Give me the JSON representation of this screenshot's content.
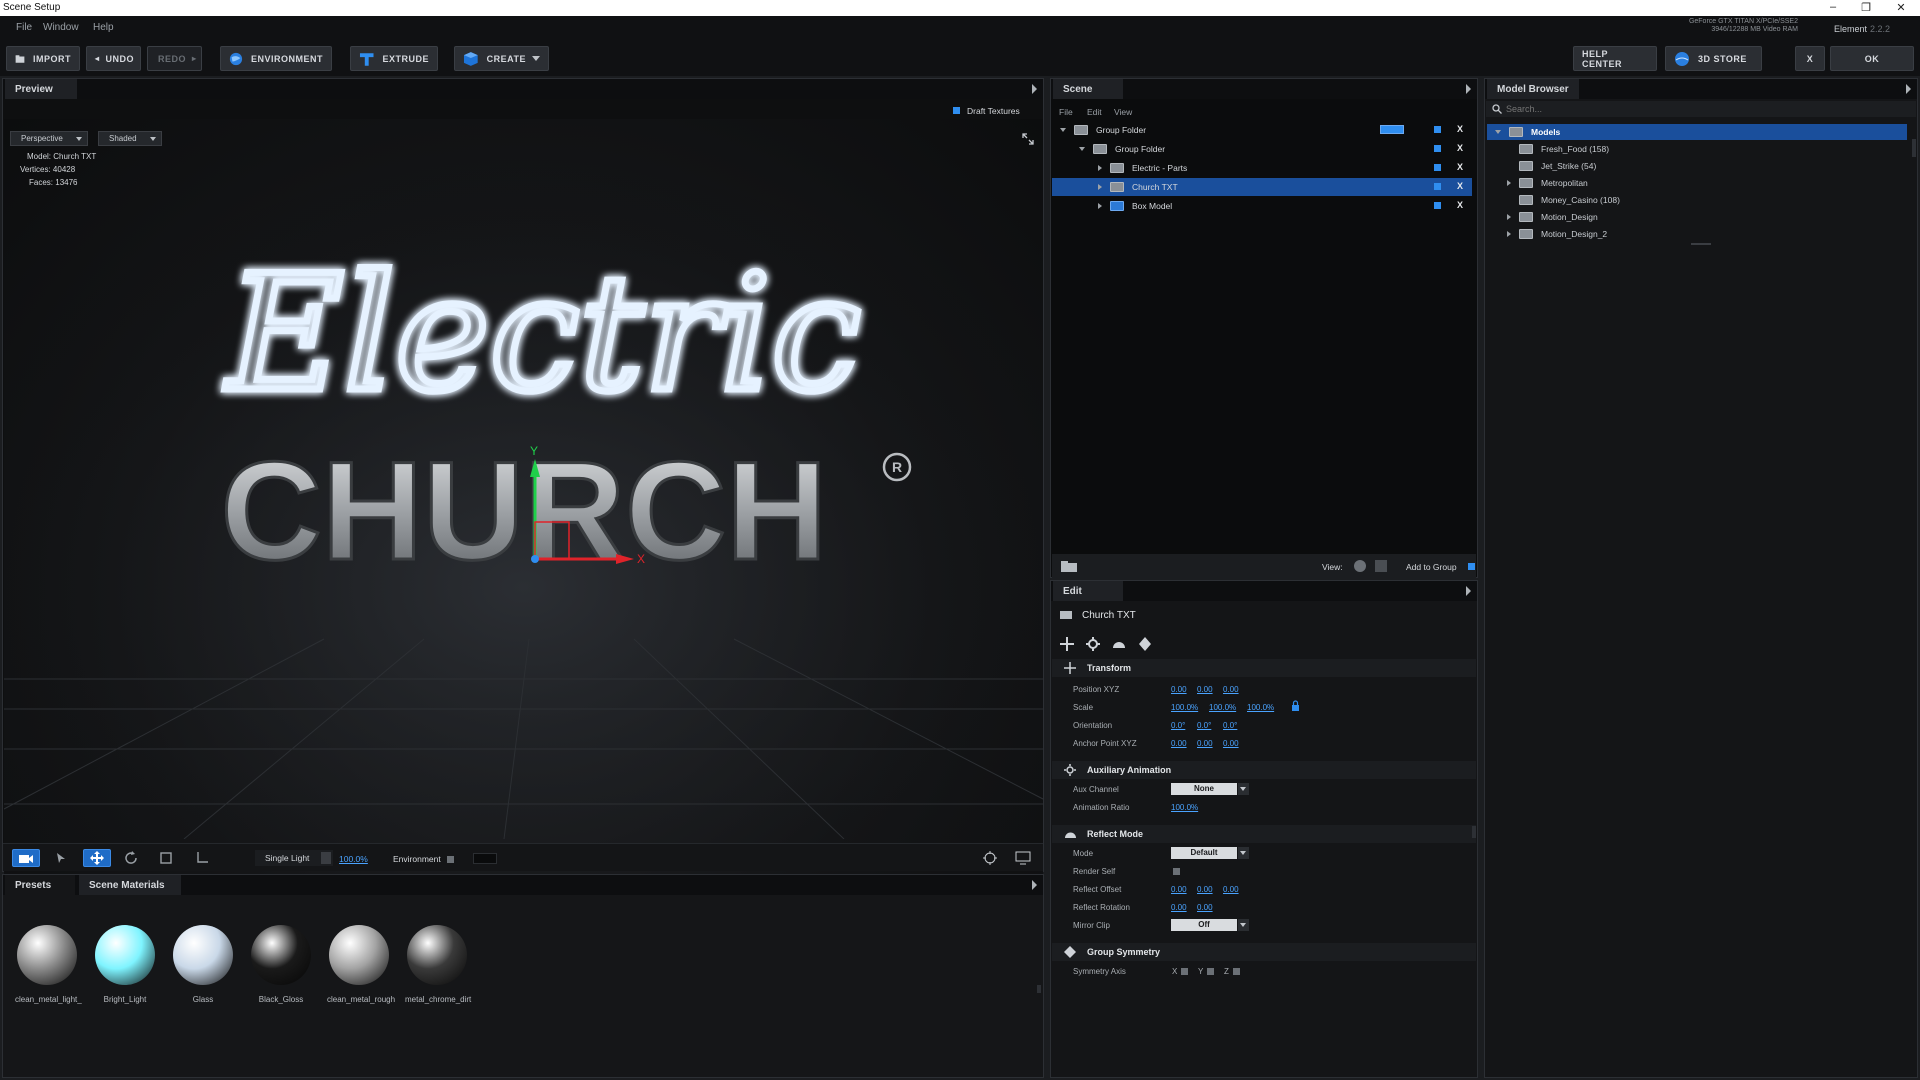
{
  "window": {
    "title": "Scene Setup",
    "controls": [
      "–",
      "❐",
      "✕"
    ]
  },
  "menu": [
    "File",
    "Window",
    "Help"
  ],
  "system": {
    "gpu_line1": "GeForce GTX TITAN X/PCIe/SSE2",
    "gpu_line2": "3946/12288 MB Video RAM",
    "app_name": "Element",
    "app_version": "2.2.2"
  },
  "toolbar": {
    "import": "IMPORT",
    "undo": "UNDO",
    "redo": "REDO",
    "environment": "ENVIRONMENT",
    "extrude": "EXTRUDE",
    "create": "CREATE",
    "help_center": "HELP CENTER",
    "store": "3D STORE",
    "close": "X",
    "ok": "OK"
  },
  "preview": {
    "tab": "Preview",
    "draft_textures": "Draft Textures",
    "camera": "Perspective",
    "shading": "Shaded",
    "info": {
      "model_label": "Model:",
      "model": "Church TXT",
      "vertices_label": "Vertices:",
      "vertices": "40428",
      "faces_label": "Faces:",
      "faces": "13476"
    },
    "scene_text_script": "Electric",
    "scene_text_block": "CHURCH",
    "registered_mark": "R",
    "axis_y": "Y",
    "axis_x": "X",
    "light_mode": "Single Light",
    "light_intensity": "100.0%",
    "environment_label": "Environment"
  },
  "materials": {
    "tabs": [
      "Presets",
      "Scene Materials"
    ],
    "items": [
      {
        "name": "clean_metal_light_",
        "color": "#8c8c8c"
      },
      {
        "name": "Bright_Light",
        "color": "#7ff4ff"
      },
      {
        "name": "Glass",
        "color": "#c9d8e8"
      },
      {
        "name": "Black_Gloss",
        "color": "#1a1a1a"
      },
      {
        "name": "clean_metal_rough",
        "color": "#a3a3a3"
      },
      {
        "name": "metal_chrome_dirt",
        "color": "#3a3a3a"
      }
    ]
  },
  "scene": {
    "tab": "Scene",
    "menu": [
      "File",
      "Edit",
      "View"
    ],
    "tree": [
      {
        "label": "Group Folder",
        "level": 0,
        "expanded": true
      },
      {
        "label": "Group Folder",
        "level": 1,
        "expanded": true
      },
      {
        "label": "Electric - Parts",
        "level": 2,
        "expanded": false
      },
      {
        "label": "Church TXT",
        "level": 2,
        "expanded": false,
        "selected": true
      },
      {
        "label": "Box Model",
        "level": 2,
        "expanded": false
      }
    ],
    "delete_label": "X",
    "view_label": "View:",
    "add_to_group": "Add to Group"
  },
  "edit": {
    "tab": "Edit",
    "object_name": "Church TXT",
    "transform": {
      "title": "Transform",
      "position_label": "Position XYZ",
      "position": [
        "0.00",
        "0.00",
        "0.00"
      ],
      "scale_label": "Scale",
      "scale": [
        "100.0%",
        "100.0%",
        "100.0%"
      ],
      "orientation_label": "Orientation",
      "orientation": [
        "0.0°",
        "0.0°",
        "0.0°"
      ],
      "anchor_label": "Anchor Point XYZ",
      "anchor": [
        "0.00",
        "0.00",
        "0.00"
      ]
    },
    "aux": {
      "title": "Auxiliary Animation",
      "channel_label": "Aux Channel",
      "channel": "None",
      "ratio_label": "Animation Ratio",
      "ratio": "100.0%"
    },
    "reflect": {
      "title": "Reflect Mode",
      "mode_label": "Mode",
      "mode": "Default",
      "render_self_label": "Render Self",
      "offset_label": "Reflect Offset",
      "offset": [
        "0.00",
        "0.00",
        "0.00"
      ],
      "rotation_label": "Reflect Rotation",
      "rotation": [
        "0.00",
        "0.00"
      ],
      "mirror_label": "Mirror Clip",
      "mirror": "Off"
    },
    "symmetry": {
      "title": "Group Symmetry",
      "axis_label": "Symmetry Axis",
      "x": "X",
      "y": "Y",
      "z": "Z"
    }
  },
  "browser": {
    "tab": "Model Browser",
    "search_placeholder": "Search...",
    "items": [
      {
        "label": "Models",
        "level": 0,
        "expanded": true,
        "selected": true
      },
      {
        "label": "Fresh_Food (158)",
        "level": 1,
        "expandable": false
      },
      {
        "label": "Jet_Strike (54)",
        "level": 1,
        "expandable": false
      },
      {
        "label": "Metropolitan",
        "level": 1,
        "expandable": true
      },
      {
        "label": "Money_Casino (108)",
        "level": 1,
        "expandable": false
      },
      {
        "label": "Motion_Design",
        "level": 1,
        "expandable": true
      },
      {
        "label": "Motion_Design_2",
        "level": 1,
        "expandable": true
      }
    ]
  },
  "colors": {
    "accent": "#1f6cc7",
    "selection": "#1a4f9c",
    "link": "#4aa3ff"
  }
}
